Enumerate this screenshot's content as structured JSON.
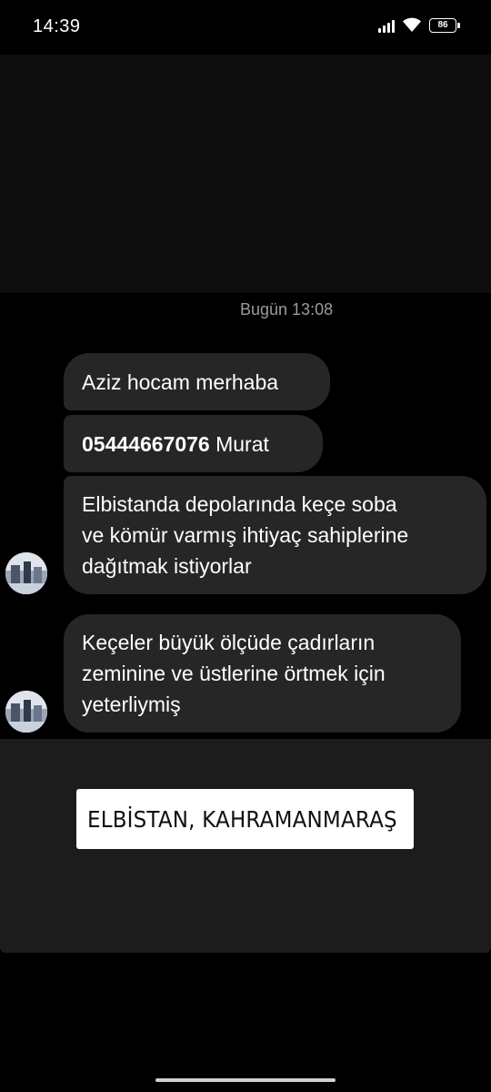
{
  "status_bar": {
    "time": "14:39",
    "battery": "86",
    "icons": [
      "signal-icon",
      "wifi-icon",
      "battery-icon"
    ]
  },
  "chat": {
    "date_label": "Bugün 13:08",
    "messages": [
      {
        "text": "Aziz hocam merhaba"
      },
      {
        "phone": "05444667076",
        "name": " Murat"
      },
      {
        "text": "Elbistanda depolarında keçe soba\nve kömür varmış ihtiyaç sahiplerine\ndağıtmak istiyorlar"
      },
      {
        "text": "Keçeler büyük ölçüde çadırların\nzeminine ve üstlerine örtmek için\nyeterliymiş"
      }
    ]
  },
  "story": {
    "location": "ELBİSTAN, KAHRAMANMARAŞ"
  },
  "colors": {
    "bubble": "#262626",
    "background": "#000000",
    "panel": "#1c1c1c",
    "pin_gradient": [
      "#f9a03f",
      "#e2347a"
    ]
  }
}
